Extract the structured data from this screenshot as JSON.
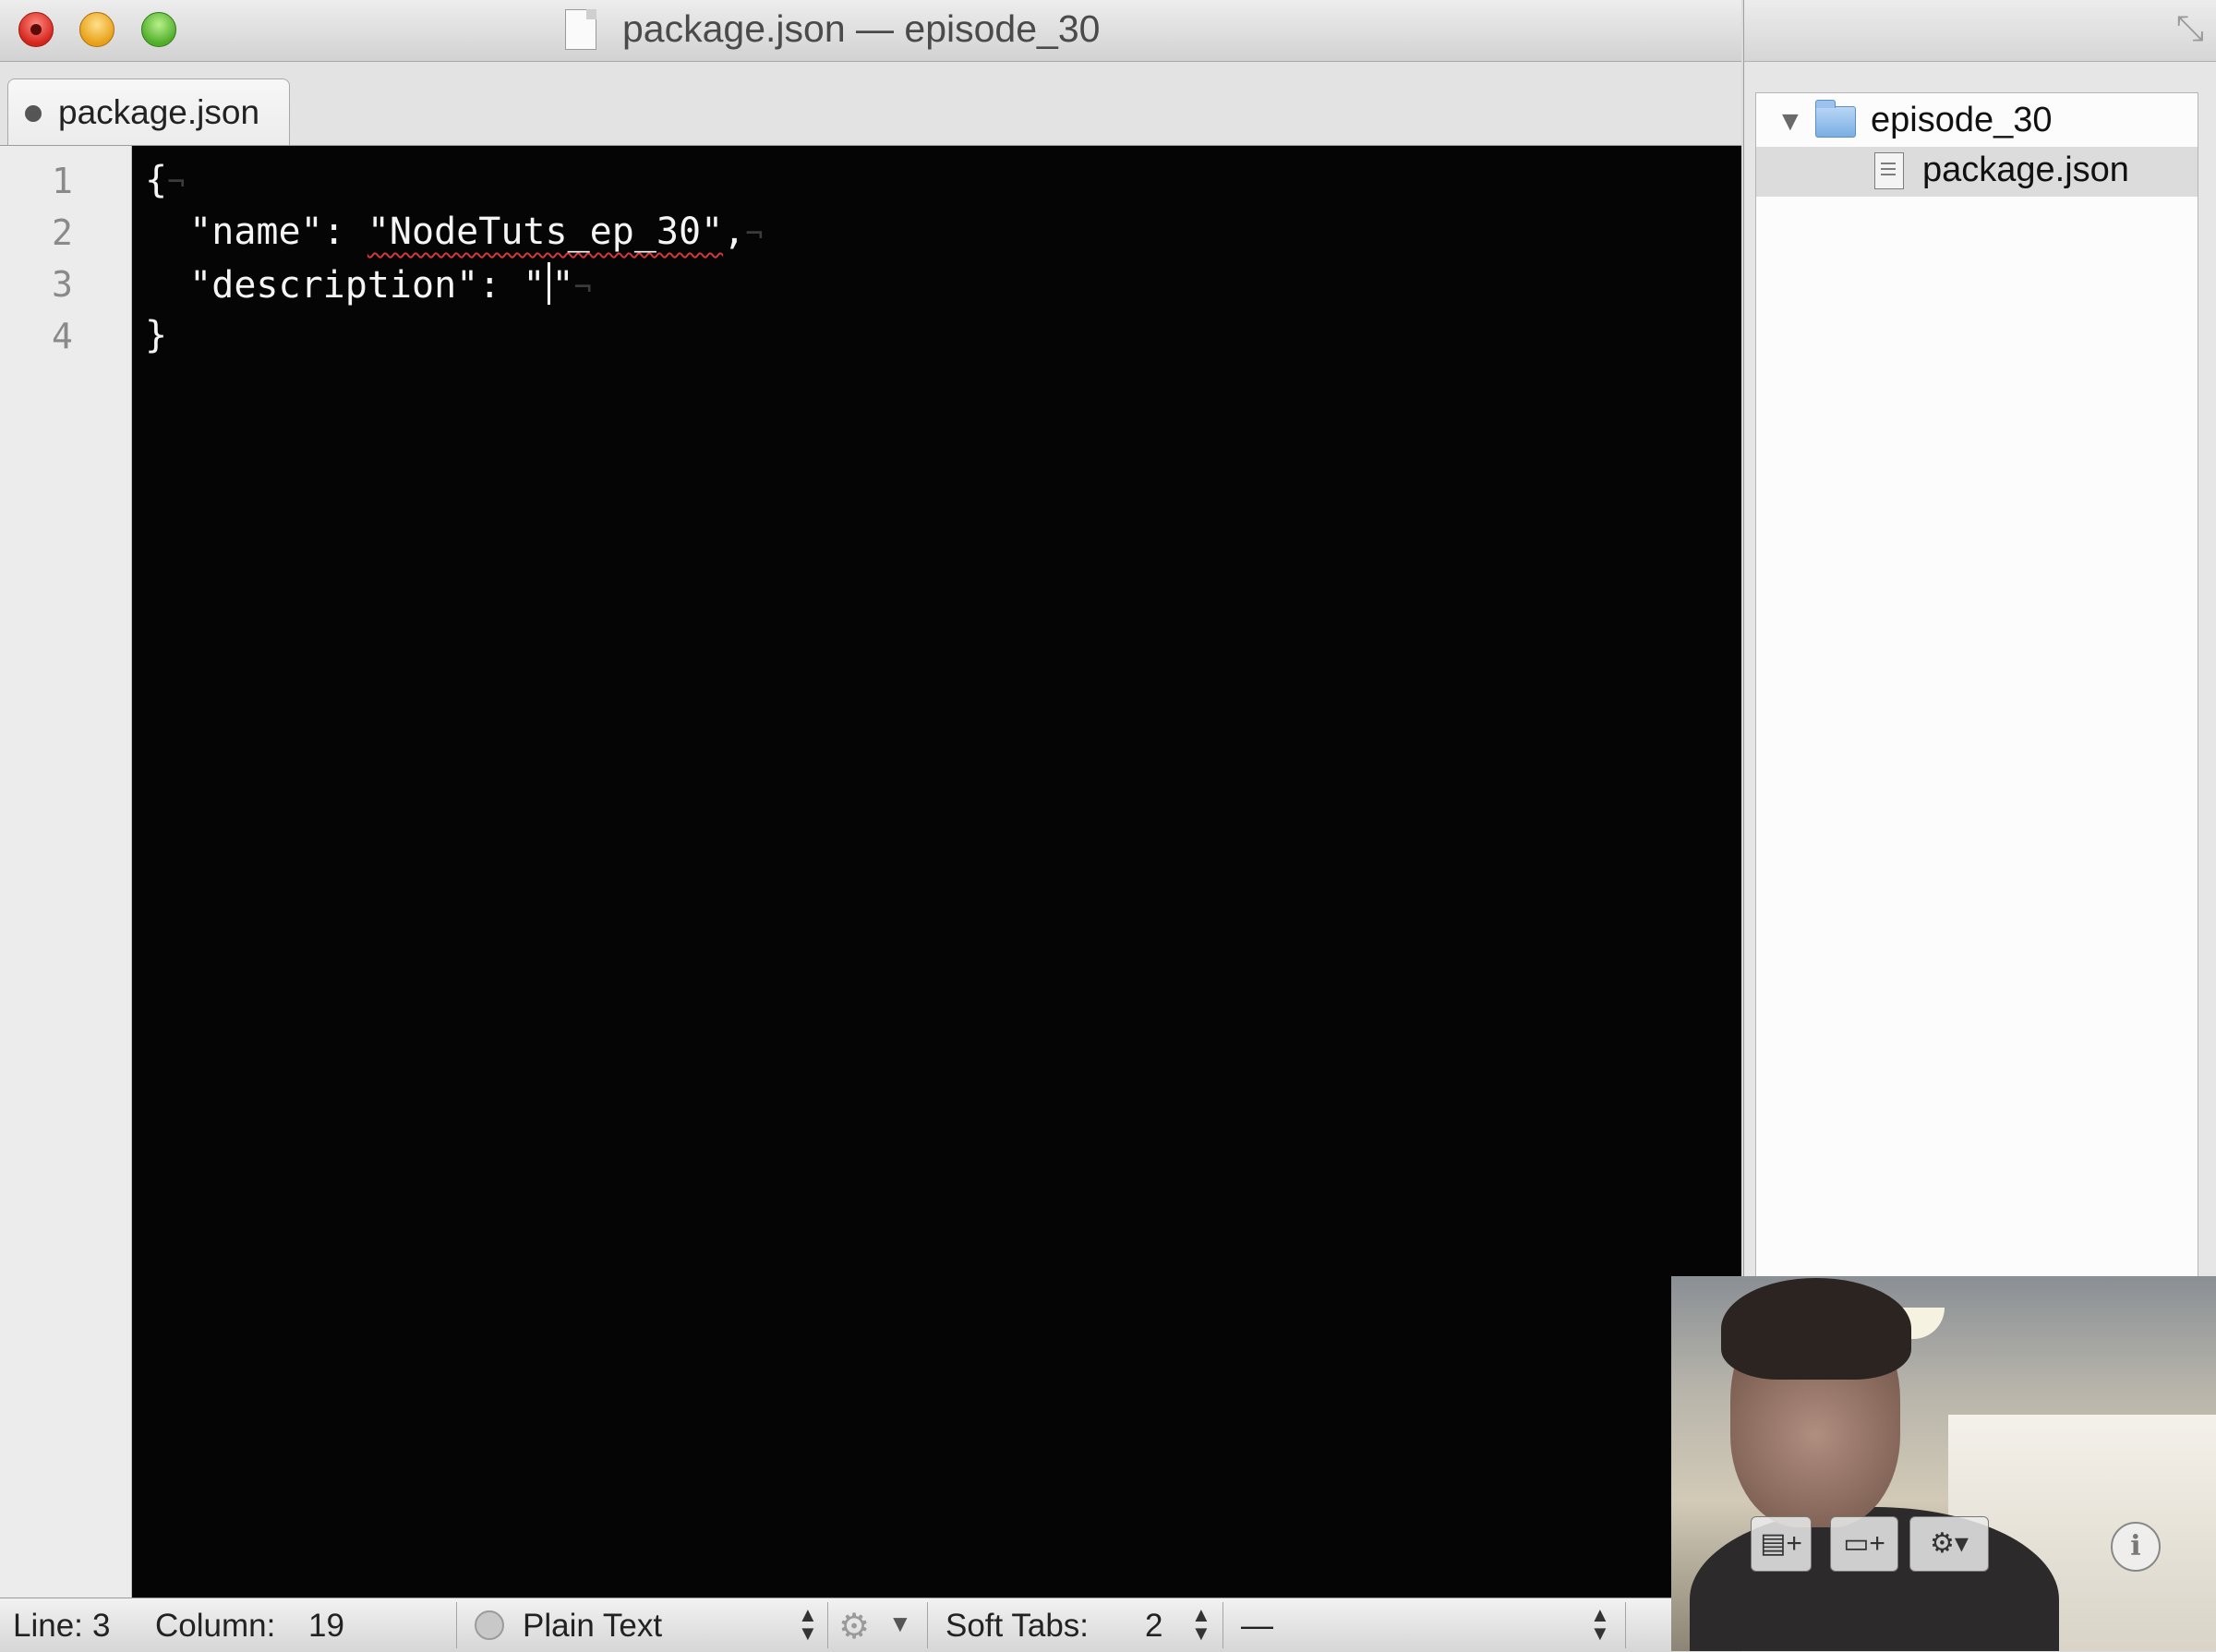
{
  "window": {
    "title": "package.json — episode_30"
  },
  "tabs": [
    {
      "label": "package.json"
    }
  ],
  "editor": {
    "line_numbers": [
      "1",
      "2",
      "3",
      "4"
    ],
    "line1": "{",
    "line2_indent": "  ",
    "line2_key": "\"name\"",
    "line2_colon": ": ",
    "line2_value": "\"NodeTuts_ep_30\"",
    "line2_comma": ",",
    "line3_indent": "  ",
    "line3_key": "\"description\"",
    "line3_colon": ": ",
    "line3_open_quote": "\"",
    "line3_close_quote": "\"",
    "line4": "}",
    "eol_marker": "¬"
  },
  "statusbar": {
    "line_label": "Line:",
    "line_value": "3",
    "column_label": "Column:",
    "column_value": "19",
    "language": "Plain Text",
    "soft_tabs_label": "Soft Tabs:",
    "soft_tabs_value": "2",
    "symbol": "—"
  },
  "project": {
    "folder": "episode_30",
    "file": "package.json"
  },
  "icons": {
    "close": "close-icon",
    "minimize": "minimize-icon",
    "maximize": "maximize-icon",
    "document": "document-icon",
    "folder": "folder-icon",
    "file": "file-icon",
    "new_file": "new-file-icon",
    "new_folder": "new-folder-icon",
    "gear": "gear-icon",
    "info": "info-icon"
  },
  "colors": {
    "editor_background": "#050505",
    "editor_text": "#f5f5f5",
    "spell_error": "#d0383a"
  }
}
